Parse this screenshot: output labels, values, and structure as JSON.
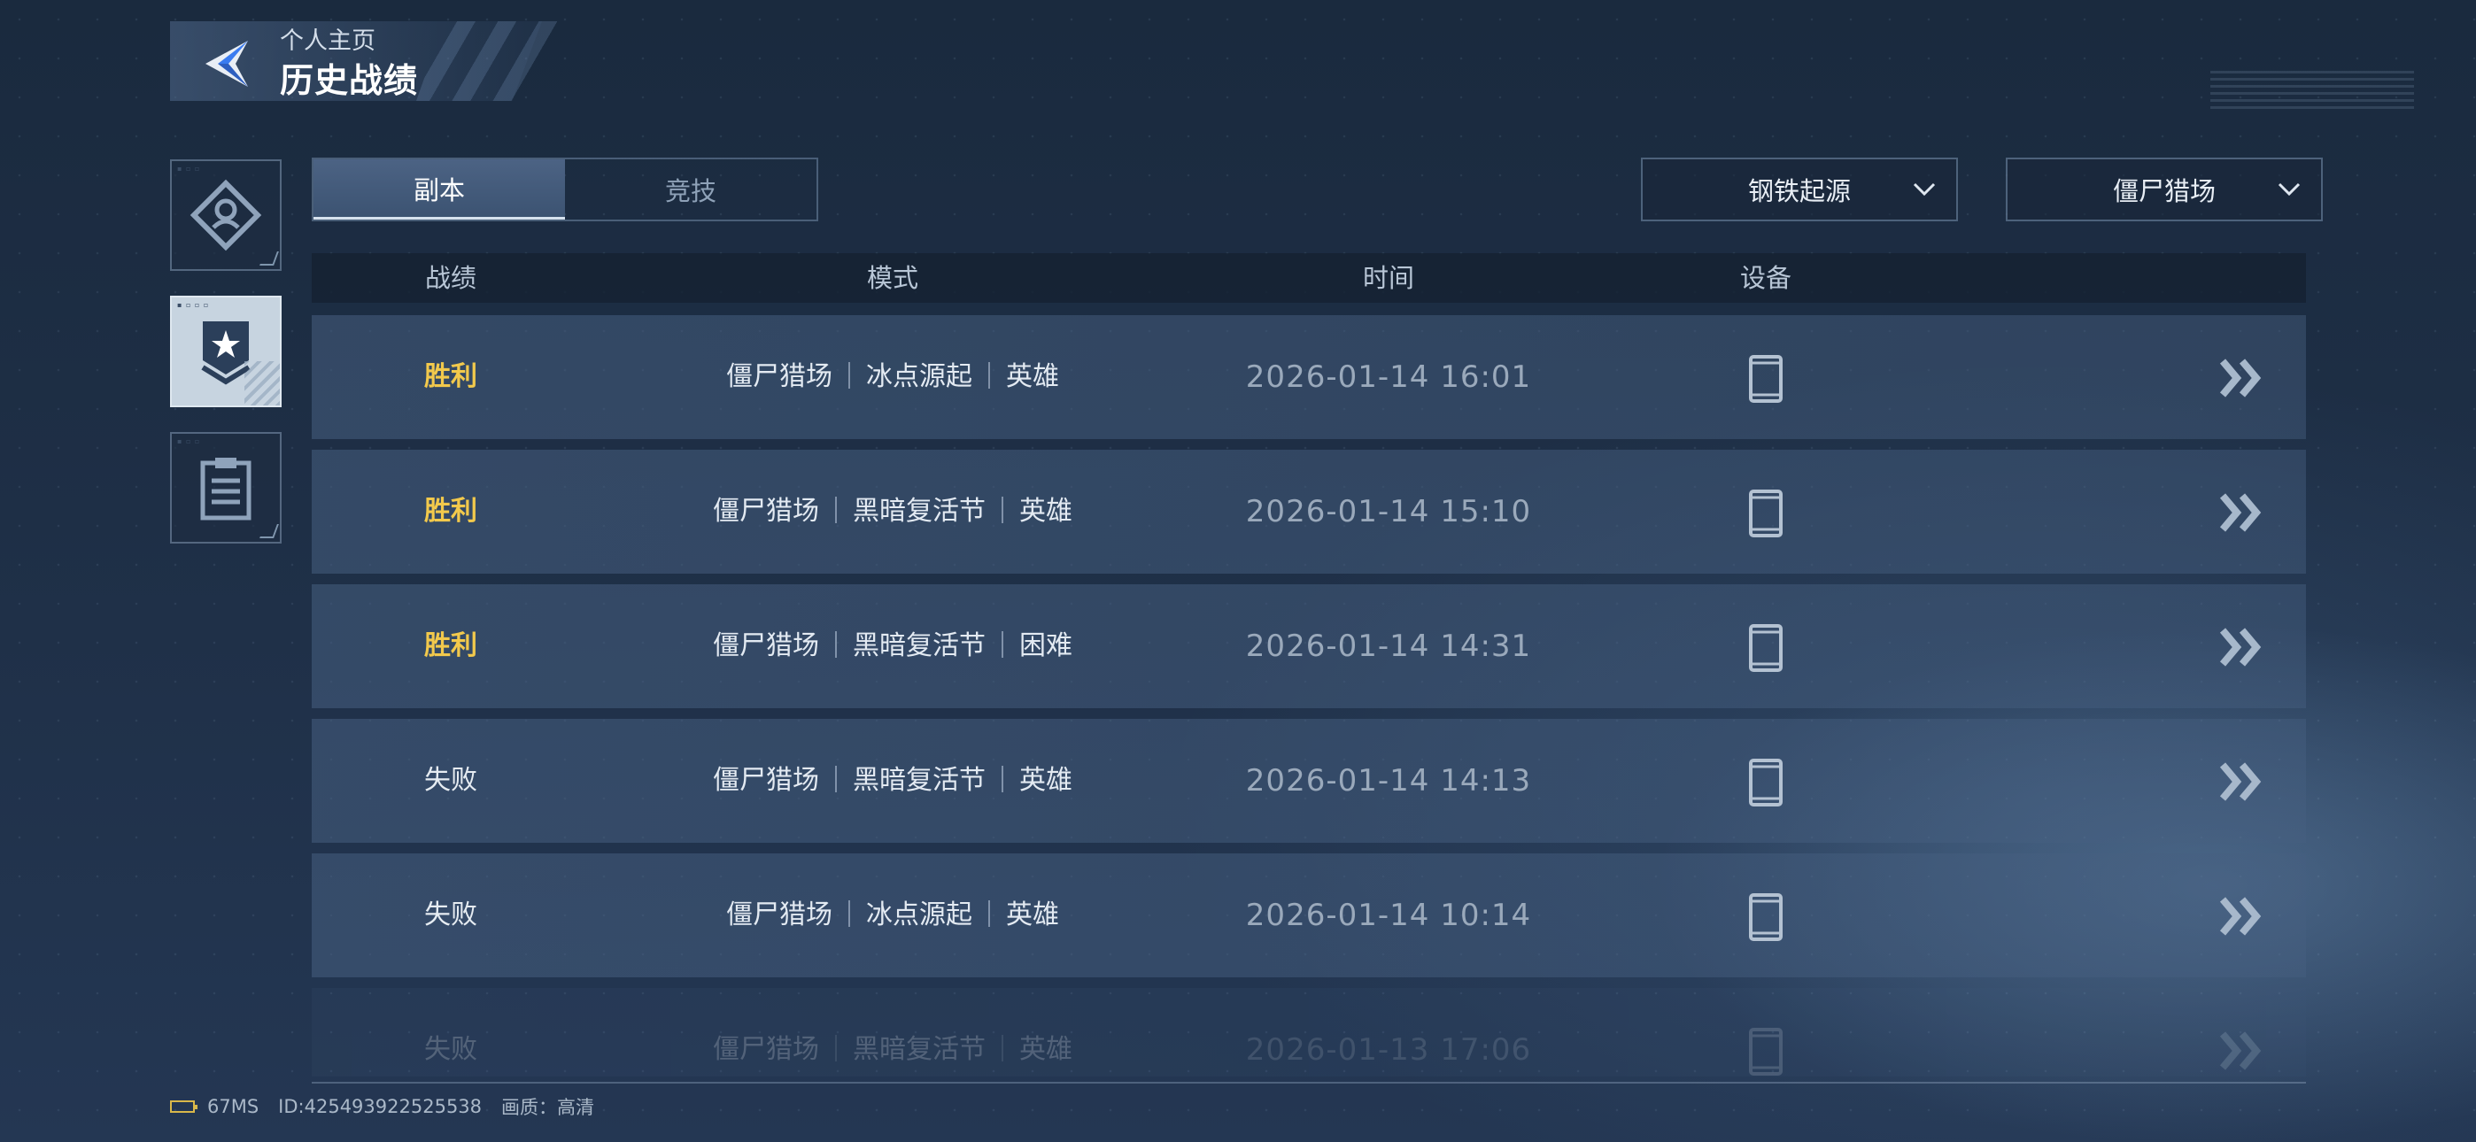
{
  "header": {
    "subtitle": "个人主页",
    "title": "历史战绩"
  },
  "tabs": [
    {
      "label": "副本",
      "active": true
    },
    {
      "label": "竞技",
      "active": false
    }
  ],
  "filters": {
    "season": "钢铁起源",
    "mode": "僵尸猎场"
  },
  "table": {
    "columns": [
      "战绩",
      "模式",
      "时间",
      "设备"
    ],
    "rows": [
      {
        "result": "胜利",
        "win": true,
        "mode": [
          "僵尸猎场",
          "冰点源起",
          "英雄"
        ],
        "time": "2026-01-14 16:01"
      },
      {
        "result": "胜利",
        "win": true,
        "mode": [
          "僵尸猎场",
          "黑暗复活节",
          "英雄"
        ],
        "time": "2026-01-14 15:10"
      },
      {
        "result": "胜利",
        "win": true,
        "mode": [
          "僵尸猎场",
          "黑暗复活节",
          "困难"
        ],
        "time": "2026-01-14 14:31"
      },
      {
        "result": "失败",
        "win": false,
        "mode": [
          "僵尸猎场",
          "黑暗复活节",
          "英雄"
        ],
        "time": "2026-01-14 14:13"
      },
      {
        "result": "失败",
        "win": false,
        "mode": [
          "僵尸猎场",
          "冰点源起",
          "英雄"
        ],
        "time": "2026-01-14 10:14"
      },
      {
        "result": "失败",
        "win": false,
        "mode": [
          "僵尸猎场",
          "黑暗复活节",
          "英雄"
        ],
        "time": "2026-01-13 17:06"
      }
    ]
  },
  "status_bar": {
    "ping": "67MS",
    "id": "ID:425493922525538",
    "quality": "画质：高清"
  },
  "colors": {
    "win": "#f2c94c",
    "lose": "#e6ecf2",
    "accent": "#3a7bf0"
  },
  "icons": {
    "back": "back-arrow-icon",
    "sidebar": [
      "profile-badge-icon",
      "rank-shield-icon",
      "clipboard-icon"
    ],
    "device": "phone-icon",
    "detail": "double-chevron-right-icon",
    "dropdown": "chevron-down-icon"
  }
}
